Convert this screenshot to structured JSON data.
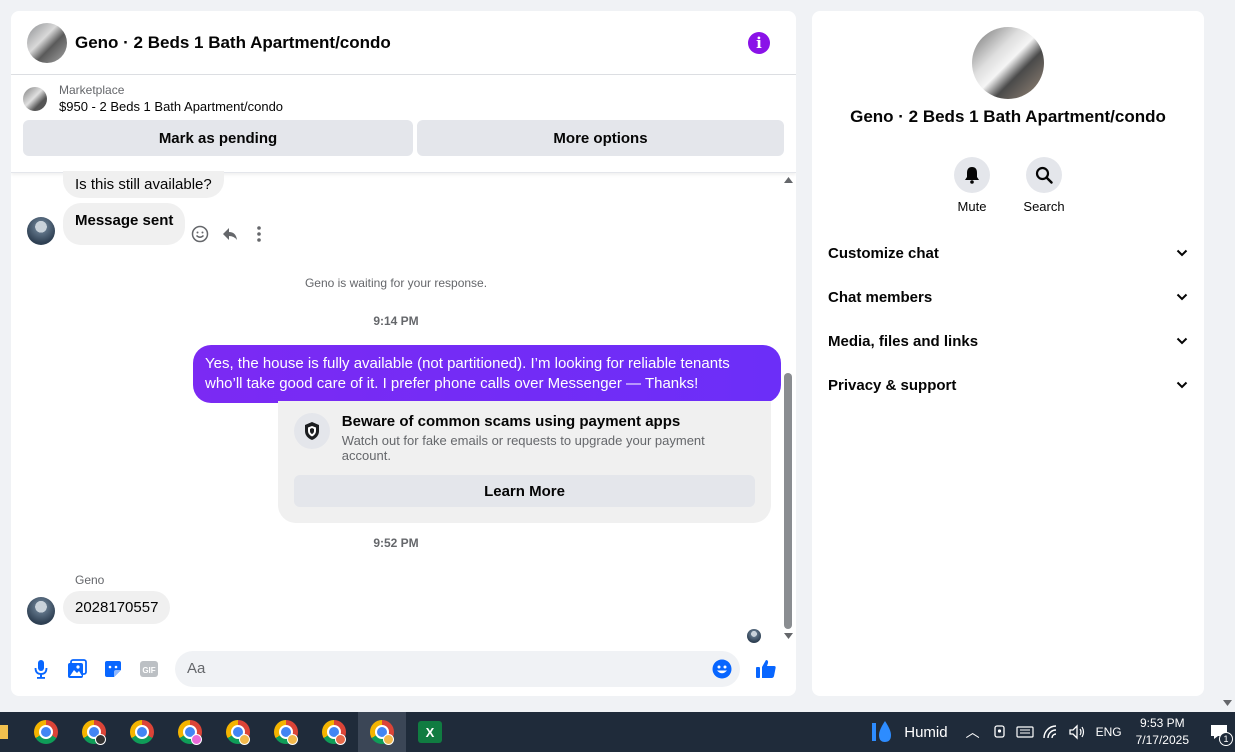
{
  "chat": {
    "title": "Geno · 2 Beds 1 Bath Apartment/condo",
    "marketplace_label": "Marketplace",
    "listing": "$950 - 2 Beds 1 Bath Apartment/condo",
    "mark_pending": "Mark as pending",
    "more_options": "More options"
  },
  "messages": {
    "first": "Is this still available?",
    "sent": "Message sent",
    "waiting": "Geno is waiting for your response.",
    "time1": "9:14 PM",
    "outgoing": "Yes, the house is fully available (not partitioned). I’m looking for reliable tenants who’ll take good care of it. I prefer phone calls over Messenger —  Thanks!",
    "scam_title": "Beware of common scams using payment apps",
    "scam_sub": "Watch out for fake emails or requests to upgrade your payment account.",
    "learn_more": "Learn More",
    "time2": "9:52 PM",
    "sender": "Geno",
    "reply": "2028170557"
  },
  "composer": {
    "placeholder": "Aa"
  },
  "info": {
    "name": "Geno · 2 Beds 1 Bath Apartment/condo",
    "mute": "Mute",
    "search": "Search",
    "sections": [
      "Customize chat",
      "Chat members",
      "Media, files and links",
      "Privacy & support"
    ]
  },
  "taskbar": {
    "weather": "Humid",
    "lang": "ENG",
    "time": "9:53 PM",
    "date": "7/17/2025",
    "notif_count": "1",
    "badge_colors": [
      "#e86ad8",
      "#f2b84b",
      "#f2b84b",
      "#e86a4a",
      "#f2b84b"
    ]
  }
}
